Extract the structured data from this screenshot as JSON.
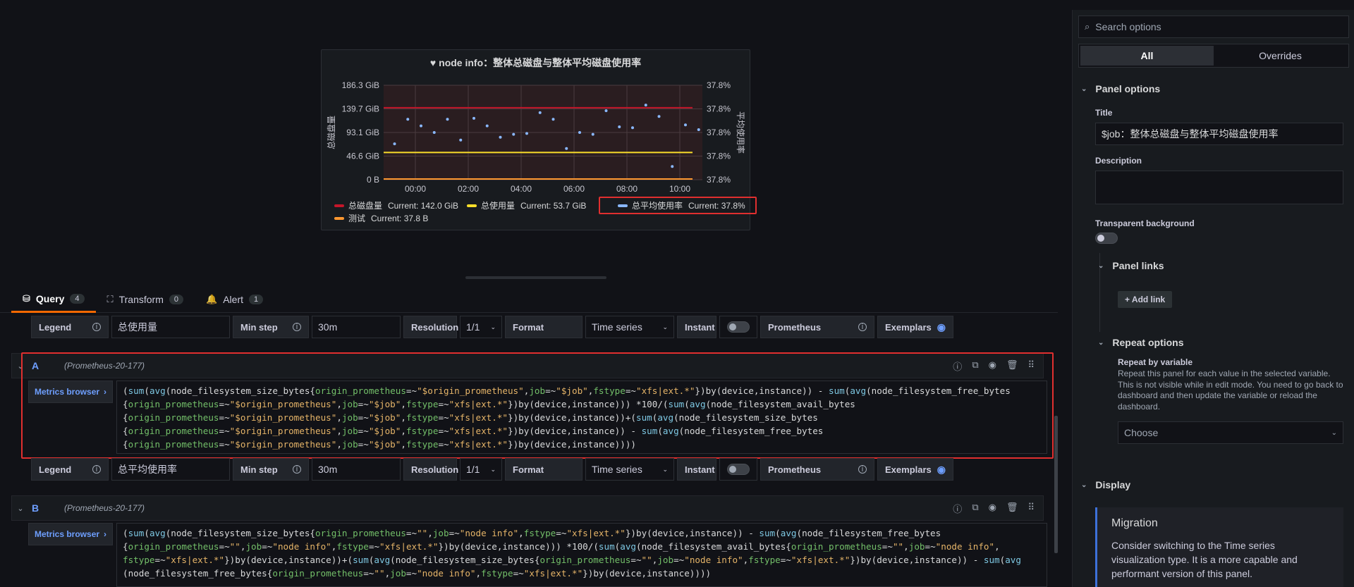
{
  "panel": {
    "title": "node info：整体总磁盘与整体平均磁盘使用率",
    "y_left_label": "总磁盘量",
    "y_right_label": "平均使用率",
    "legend": [
      {
        "name": "总磁盘量",
        "current": "Current: 142.0 GiB",
        "color": "#c4162a"
      },
      {
        "name": "总使用量",
        "current": "Current: 53.7 GiB",
        "color": "#fade2a"
      },
      {
        "name": "总平均使用率",
        "current": "Current: 37.8%",
        "color": "#8ab8ff"
      },
      {
        "name": "测试",
        "current": "Current: 37.8 B",
        "color": "#ff9830"
      }
    ]
  },
  "chart_data": {
    "type": "line",
    "x_ticks": [
      "00:00",
      "02:00",
      "04:00",
      "06:00",
      "08:00",
      "10:00"
    ],
    "y_left_ticks": [
      "186.3 GiB",
      "139.7 GiB",
      "93.1 GiB",
      "46.6 GiB",
      "0 B"
    ],
    "y_right_ticks": [
      "37.8%",
      "37.8%",
      "37.8%",
      "37.8%",
      "37.8%"
    ],
    "ylim_left_gib": [
      0,
      186.3
    ],
    "series": [
      {
        "name": "总磁盘量",
        "axis": "left",
        "constant": 142.0,
        "color": "#c4162a"
      },
      {
        "name": "总使用量",
        "axis": "left",
        "constant": 53.7,
        "color": "#fade2a"
      },
      {
        "name": "测试",
        "axis": "left",
        "constant": 0,
        "color": "#ff9830"
      },
      {
        "name": "总平均使用率",
        "axis": "right",
        "style": "points",
        "color": "#8ab8ff",
        "x_hours": [
          -1.0,
          -0.5,
          0.0,
          0.5,
          1.0,
          1.5,
          2.0,
          2.5,
          3.0,
          3.5,
          4.0,
          4.5,
          5.0,
          5.5,
          6.0,
          6.5,
          7.0,
          7.5,
          8.0,
          8.5,
          9.0,
          9.5,
          10.0,
          10.5
        ],
        "y_rel": [
          0.38,
          0.64,
          0.57,
          0.5,
          0.64,
          0.42,
          0.65,
          0.57,
          0.45,
          0.48,
          0.49,
          0.71,
          0.64,
          0.33,
          0.5,
          0.48,
          0.73,
          0.56,
          0.55,
          0.79,
          0.67,
          0.14,
          0.58,
          0.53
        ]
      }
    ]
  },
  "tabs": [
    {
      "label": "Query",
      "count": "4",
      "icon": "database-icon",
      "glyph": "⛁"
    },
    {
      "label": "Transform",
      "count": "0",
      "icon": "transform-icon",
      "glyph": "⛶"
    },
    {
      "label": "Alert",
      "count": "1",
      "icon": "bell-icon",
      "glyph": "🔔"
    }
  ],
  "option_rows": [
    {
      "legend_label": "Legend",
      "legend_value": "总使用量",
      "min_step_label": "Min step",
      "min_step_value": "30m",
      "resolution_label": "Resolution",
      "resolution_value": "1/1",
      "format_label": "Format",
      "format_value": "Time series",
      "instant_label": "Instant",
      "prometheus_label": "Prometheus",
      "exemplars_label": "Exemplars"
    },
    {
      "legend_label": "Legend",
      "legend_value": "总平均使用率",
      "min_step_label": "Min step",
      "min_step_value": "30m",
      "resolution_label": "Resolution",
      "resolution_value": "1/1",
      "format_label": "Format",
      "format_value": "Time series",
      "instant_label": "Instant",
      "prometheus_label": "Prometheus",
      "exemplars_label": "Exemplars"
    }
  ],
  "queries": [
    {
      "id": "A",
      "datasource": "(Prometheus-20-177)",
      "metrics_browser": "Metrics browser",
      "expr_lines": [
        "(sum(avg(node_filesystem_size_bytes{origin_prometheus=~\"$origin_prometheus\",job=~\"$job\",fstype=~\"xfs|ext.*\"})by(device,instance)) - sum(avg(node_filesystem_free_bytes",
        "{origin_prometheus=~\"$origin_prometheus\",job=~\"$job\",fstype=~\"xfs|ext.*\"})by(device,instance))) *100/(sum(avg(node_filesystem_avail_bytes",
        "{origin_prometheus=~\"$origin_prometheus\",job=~\"$job\",fstype=~\"xfs|ext.*\"})by(device,instance))+(sum(avg(node_filesystem_size_bytes",
        "{origin_prometheus=~\"$origin_prometheus\",job=~\"$job\",fstype=~\"xfs|ext.*\"})by(device,instance)) - sum(avg(node_filesystem_free_bytes",
        "{origin_prometheus=~\"$origin_prometheus\",job=~\"$job\",fstype=~\"xfs|ext.*\"})by(device,instance))))"
      ]
    },
    {
      "id": "B",
      "datasource": "(Prometheus-20-177)",
      "metrics_browser": "Metrics browser",
      "expr_lines": [
        "(sum(avg(node_filesystem_size_bytes{origin_prometheus=~\"\",job=~\"node info\",fstype=~\"xfs|ext.*\"})by(device,instance)) - sum(avg(node_filesystem_free_bytes",
        "{origin_prometheus=~\"\",job=~\"node info\",fstype=~\"xfs|ext.*\"})by(device,instance))) *100/(sum(avg(node_filesystem_avail_bytes{origin_prometheus=~\"\",job=~\"node info\",",
        "fstype=~\"xfs|ext.*\"})by(device,instance))+(sum(avg(node_filesystem_size_bytes{origin_prometheus=~\"\",job=~\"node info\",fstype=~\"xfs|ext.*\"})by(device,instance)) - sum(avg",
        "(node_filesystem_free_bytes{origin_prometheus=~\"\",job=~\"node info\",fstype=~\"xfs|ext.*\"})by(device,instance))))"
      ]
    }
  ],
  "options_pane": {
    "search_placeholder": "Search options",
    "tab_all": "All",
    "tab_overrides": "Overrides",
    "panel_options": "Panel options",
    "title_label": "Title",
    "title_value": "$job：整体总磁盘与整体平均磁盘使用率",
    "description_label": "Description",
    "transparent_label": "Transparent background",
    "panel_links": "Panel links",
    "add_link": "+ Add link",
    "repeat_options": "Repeat options",
    "repeat_by_label": "Repeat by variable",
    "repeat_help": "Repeat this panel for each value in the selected variable. This is not visible while in edit mode. You need to go back to dashboard and then update the variable or reload the dashboard.",
    "choose_placeholder": "Choose",
    "display": "Display",
    "migration_title": "Migration",
    "migration_body": "Consider switching to the Time series visualization type. It is a more capable and performant version of this panel."
  }
}
